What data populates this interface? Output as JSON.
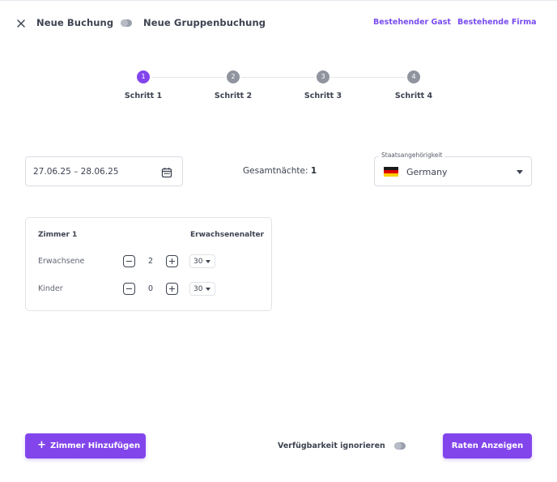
{
  "header": {
    "new_booking": "Neue Buchung",
    "new_group_booking": "Neue Gruppenbuchung",
    "existing_guest": "Bestehender Gast",
    "existing_company": "Bestehende Firma"
  },
  "steps": [
    {
      "number": "1",
      "label": "Schritt 1",
      "active": true
    },
    {
      "number": "2",
      "label": "Schritt 2",
      "active": false
    },
    {
      "number": "3",
      "label": "Schritt 3",
      "active": false
    },
    {
      "number": "4",
      "label": "Schritt 4",
      "active": false
    }
  ],
  "booking": {
    "date_range": "27.06.25 – 28.06.25",
    "nights_label": "Gesamtnächte:",
    "nights_value": "1",
    "nationality_label": "Staatsangehörigkeit",
    "nationality_value": "Germany"
  },
  "room": {
    "title": "Zimmer 1",
    "age_header": "Erwachsenenalter",
    "adults_label": "Erwachsene",
    "adults_value": "2",
    "adults_age": "30",
    "children_label": "Kinder",
    "children_value": "0",
    "children_age": "30"
  },
  "footer": {
    "add_room_icon": "+",
    "add_room": "Zimmer Hinzufügen",
    "ignore_availability": "Verfügbarkeit ignorieren",
    "show_rates": "Raten Anzeigen"
  },
  "colors": {
    "accent": "#8245ec",
    "link": "#7a4cf0",
    "inactive_step": "#8f949e"
  }
}
